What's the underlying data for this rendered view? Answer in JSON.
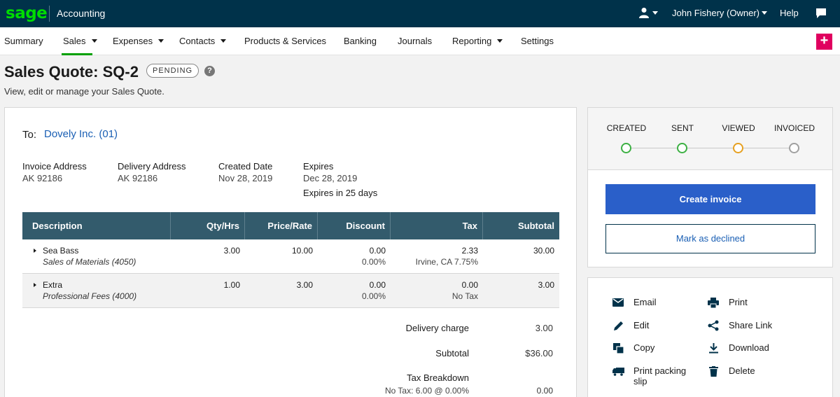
{
  "topbar": {
    "logo": "sage",
    "app_name": "Accounting",
    "user_name": "John Fishery (Owner)",
    "help": "Help"
  },
  "nav": {
    "items": [
      {
        "label": "Summary",
        "dropdown": false
      },
      {
        "label": "Sales",
        "dropdown": true,
        "active": true
      },
      {
        "label": "Expenses",
        "dropdown": true
      },
      {
        "label": "Contacts",
        "dropdown": true
      },
      {
        "label": "Products & Services",
        "dropdown": false
      },
      {
        "label": "Banking",
        "dropdown": false
      },
      {
        "label": "Journals",
        "dropdown": false
      },
      {
        "label": "Reporting",
        "dropdown": true
      },
      {
        "label": "Settings",
        "dropdown": false
      }
    ],
    "plus": "+"
  },
  "page": {
    "title": "Sales Quote: SQ-2",
    "status": "PENDING",
    "help": "?",
    "subtitle": "View, edit or manage your Sales Quote."
  },
  "quote": {
    "to_label": "To:",
    "to_contact": "Dovely Inc. (01)",
    "invoice_address_label": "Invoice Address",
    "invoice_address": "AK 92186",
    "delivery_address_label": "Delivery Address",
    "delivery_address": "AK 92186",
    "created_date_label": "Created Date",
    "created_date": "Nov 28, 2019",
    "expires_label": "Expires",
    "expires": "Dec 28, 2019",
    "expires_in": "Expires in 25 days"
  },
  "table": {
    "headers": {
      "description": "Description",
      "qty": "Qty/Hrs",
      "price": "Price/Rate",
      "discount": "Discount",
      "tax": "Tax",
      "subtotal": "Subtotal"
    },
    "rows": [
      {
        "name": "Sea Bass",
        "ledger": "Sales of Materials (4050)",
        "qty": "3.00",
        "price": "10.00",
        "discount": "0.00",
        "discount_pct": "0.00%",
        "tax": "2.33",
        "tax_rate": "Irvine, CA 7.75%",
        "subtotal": "30.00"
      },
      {
        "name": "Extra",
        "ledger": "Professional Fees (4000)",
        "qty": "1.00",
        "price": "3.00",
        "discount": "0.00",
        "discount_pct": "0.00%",
        "tax": "0.00",
        "tax_rate": "No Tax",
        "subtotal": "3.00"
      }
    ]
  },
  "totals": {
    "delivery_label": "Delivery charge",
    "delivery": "3.00",
    "subtotal_label": "Subtotal",
    "subtotal": "$36.00",
    "tax_breakdown_label": "Tax Breakdown",
    "tax_breakdown_line": "No Tax: 6.00 @ 0.00%",
    "tax_breakdown_value": "0.00"
  },
  "status_steps": [
    {
      "label": "CREATED",
      "color": "#3cb043"
    },
    {
      "label": "SENT",
      "color": "#3cb043"
    },
    {
      "label": "VIEWED",
      "color": "#e6a020"
    },
    {
      "label": "INVOICED",
      "color": "#a0a0a0"
    }
  ],
  "buttons": {
    "create_invoice": "Create invoice",
    "mark_declined": "Mark as declined"
  },
  "actions": {
    "email": "Email",
    "print": "Print",
    "edit": "Edit",
    "share_link": "Share Link",
    "copy": "Copy",
    "download": "Download",
    "print_packing_slip_1": "Print packing",
    "print_packing_slip_2": "slip",
    "delete": "Delete"
  }
}
